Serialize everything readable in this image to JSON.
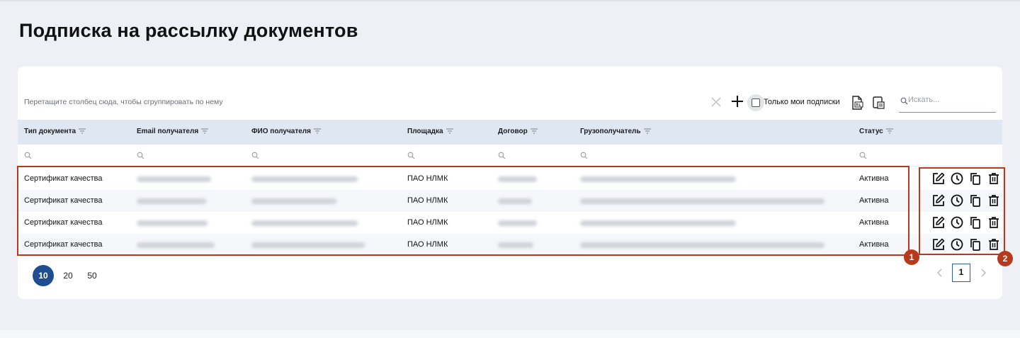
{
  "page": {
    "title": "Подписка на рассылку документов"
  },
  "toolbar": {
    "group_hint": "Перетащите столбец сюда, чтобы сгруппировать по нему",
    "clear_icon": "close-icon",
    "add_icon": "plus-icon",
    "only_my_label": "Только мои подписки",
    "only_my_checked": false,
    "export_excel_icon": "export-xls-icon",
    "export_other_icon": "export-list-icon",
    "search_placeholder": "Искать..."
  },
  "table": {
    "columns": [
      {
        "key": "doc_type",
        "label": "Тип документа"
      },
      {
        "key": "email",
        "label": "Email получателя"
      },
      {
        "key": "fio",
        "label": "ФИО получателя"
      },
      {
        "key": "site",
        "label": "Площадка"
      },
      {
        "key": "contract",
        "label": "Договор"
      },
      {
        "key": "consignee",
        "label": "Грузополучатель"
      },
      {
        "key": "status",
        "label": "Статус"
      }
    ],
    "rows": [
      {
        "doc_type": "Сертификат качества",
        "site": "ПАО НЛМК",
        "status": "Активна"
      },
      {
        "doc_type": "Сертификат качества",
        "site": "ПАО НЛМК",
        "status": "Активна"
      },
      {
        "doc_type": "Сертификат качества",
        "site": "ПАО НЛМК",
        "status": "Активна"
      },
      {
        "doc_type": "Сертификат качества",
        "site": "ПАО НЛМК",
        "status": "Активна"
      }
    ],
    "row_actions": [
      "edit-icon",
      "history-icon",
      "copy-icon",
      "delete-icon"
    ]
  },
  "annotations": {
    "badge1": "1",
    "badge2": "2",
    "color": "#b83a1e"
  },
  "pagination": {
    "page_sizes": [
      "10",
      "20",
      "50"
    ],
    "active_page_size": "10",
    "current_page": "1"
  },
  "colors": {
    "accent": "#1e4e8f",
    "header_bg": "#dfe7f3",
    "page_bg": "#eff0f5"
  }
}
